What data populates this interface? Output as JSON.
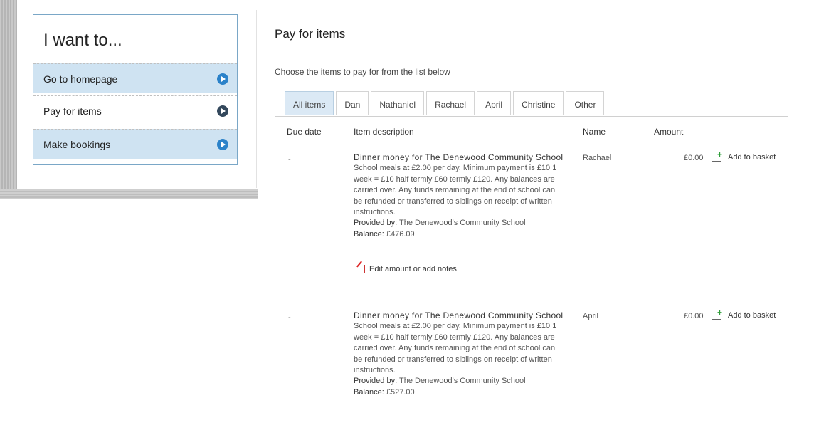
{
  "sidebar": {
    "title": "I want to...",
    "items": [
      {
        "label": "Go to homepage"
      },
      {
        "label": "Pay for items"
      },
      {
        "label": "Make bookings"
      }
    ]
  },
  "main": {
    "title": "Pay for items",
    "intro": "Choose the items to pay for from the list below",
    "tabs": [
      "All items",
      "Dan",
      "Nathaniel",
      "Rachael",
      "April",
      "Christine",
      "Other"
    ],
    "columns": {
      "due_date": "Due date",
      "item_description": "Item description",
      "name": "Name",
      "amount": "Amount"
    },
    "rows": [
      {
        "due_date": "-",
        "title": "Dinner money for The Denewood Community School",
        "description": "School meals at £2.00 per day. Minimum payment is £10 1 week = £10 half termly £60 termly £120. Any balances are carried over. Any funds remaining at the end of school can be refunded or transferred to siblings on receipt of written instructions.",
        "provided_label": "Provided by:",
        "provided_by": "The Denewood's Community School",
        "balance_label": "Balance:",
        "balance": "£476.09",
        "edit_label": "Edit amount or add notes",
        "name": "Rachael",
        "amount": "£0.00",
        "basket_label": "Add to basket"
      },
      {
        "due_date": "-",
        "title": "Dinner money for The Denewood Community School",
        "description": "School meals at £2.00 per day. Minimum payment is £10 1 week = £10 half termly £60 termly £120. Any balances are carried over. Any funds remaining at the end of school can be refunded or transferred to siblings on receipt of written instructions.",
        "provided_label": "Provided by:",
        "provided_by": "The Denewood's Community School",
        "balance_label": "Balance:",
        "balance": "£527.00",
        "name": "April",
        "amount": "£0.00",
        "basket_label": "Add to basket"
      }
    ]
  }
}
